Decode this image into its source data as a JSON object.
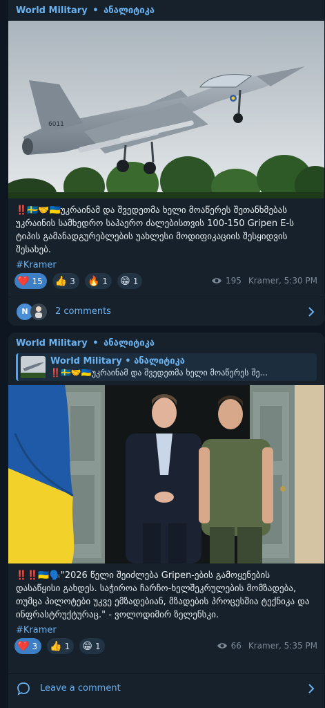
{
  "posts": [
    {
      "channel": "World Military",
      "separator": "•",
      "subtitle": "ანალიტიკა",
      "text": "‼️🇸🇪🤝🇺🇦უკრაინამ და შვედეთმა ხელი მოაწერეს შეთანხმებას უკრაინის სამხედრო საჰაერო ძალებისთვის 100-150 Gripen E-ს ტიპის გამანადგურებლების უახლესი მოდიფიკაციის შესყიდვის შესახებ.",
      "hashtag": "#Kramer",
      "reactions": [
        {
          "emoji": "❤️",
          "count": "15",
          "active": true
        },
        {
          "emoji": "👍",
          "count": "3",
          "active": false
        },
        {
          "emoji": "🔥",
          "count": "1",
          "active": false
        },
        {
          "emoji": "😁",
          "count": "1",
          "active": false
        }
      ],
      "views": "195",
      "author": "Kramer, 5:30 PM",
      "comments_avatar": "N",
      "comments_label": "2 comments"
    },
    {
      "channel": "World Military",
      "separator": "•",
      "subtitle": "ანალიტიკა",
      "reply": {
        "channel": "World Military",
        "separator": "•",
        "subtitle": "ანალიტიკა",
        "text": "‼️🇸🇪🤝🇺🇦უკრაინამ და შვედეთმა ხელი მოაწერეს შე..."
      },
      "text": "‼️‼️🇺🇦🗣️\"2026 წელი შეიძლება Gripen-ების გამოყენების დასაწყისი გახდეს. საჭიროა ჩარჩო-ხელშეკრულების მომზადება, თუმცა პილოტები უკვე ემზადებიან, მზადების პროცესშია ტექნიკა და ინფრასტრუქტურაც.\" - ვოლოდიმირ ზელენსკი.",
      "hashtag": "#Kramer",
      "reactions": [
        {
          "emoji": "❤️",
          "count": "3",
          "active": true
        },
        {
          "emoji": "👍",
          "count": "1",
          "active": false
        },
        {
          "emoji": "😁",
          "count": "1",
          "active": false
        }
      ],
      "views": "66",
      "author": "Kramer, 5:35 PM",
      "comments_label": "Leave a comment"
    }
  ],
  "colors": {
    "background": "#0e1621",
    "bubble": "#17212b",
    "accent": "#6ab3f3",
    "active_reaction": "#3d7fc4"
  },
  "icons": [
    "eye-icon",
    "chevron-right-icon",
    "comment-bubble-icon"
  ]
}
